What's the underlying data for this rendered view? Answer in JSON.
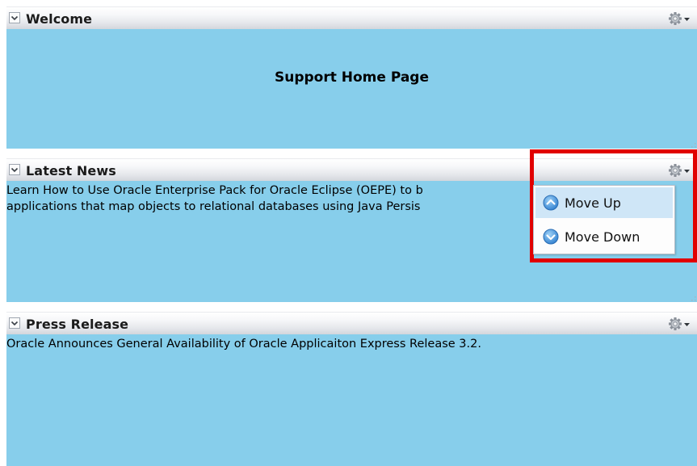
{
  "panels": [
    {
      "title": "Welcome",
      "heading": "Support Home Page",
      "body": ""
    },
    {
      "title": "Latest News",
      "body": "Learn How to Use Oracle Enterprise Pack for Oracle Eclipse (OEPE) to b\napplications that map objects to relational databases using Java Persis"
    },
    {
      "title": "Press Release",
      "body": "Oracle Announces General Availability of Oracle Applicaiton Express Release 3.2."
    }
  ],
  "menu": {
    "items": [
      {
        "label": "Move Up",
        "icon": "circle-chevron-up-icon",
        "highlighted": true
      },
      {
        "label": "Move Down",
        "icon": "circle-chevron-down-icon",
        "highlighted": false
      }
    ]
  },
  "colors": {
    "panel_body": "#87ceeb",
    "highlight_frame": "#e10000",
    "menu_hover": "#cfe6f7"
  },
  "icons": {
    "collapse": "chevron-down-icon",
    "actions": "gear-icon",
    "actions_arrow": "caret-down-icon",
    "resize": "resize-grip-icon"
  }
}
